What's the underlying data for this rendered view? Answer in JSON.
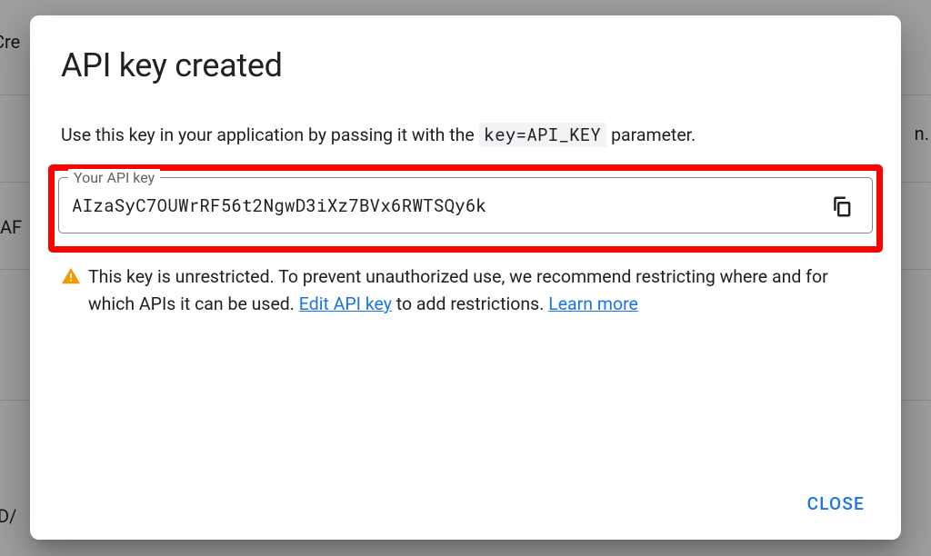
{
  "backdrop": {
    "topLeft": "Cre",
    "midLeft": "AF",
    "right": "n.",
    "bottom": "D/"
  },
  "dialog": {
    "title": "API key created",
    "description_pre": "Use this key in your application by passing it with the ",
    "description_code": "key=API_KEY",
    "description_post": " parameter.",
    "field_label": "Your API key",
    "api_key_value": "AIzaSyC7OUWrRF56t2NgwD3iXz7BVx6RWTSQy6k",
    "warning_text_1": "This key is unrestricted. To prevent unauthorized use, we recommend restricting where and for which APIs it can be used. ",
    "warning_link_1": "Edit API key",
    "warning_text_2": " to add restrictions. ",
    "warning_link_2": "Learn more",
    "close_label": "CLOSE"
  }
}
